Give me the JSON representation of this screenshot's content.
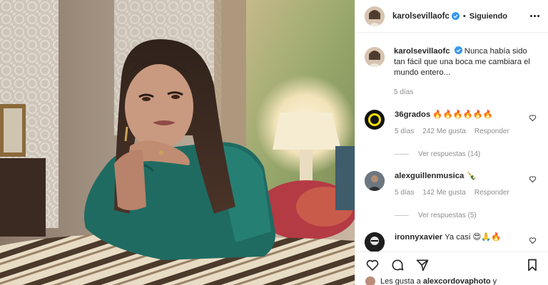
{
  "post": {
    "username": "karolsevillaofc",
    "follow_status": "Siguiendo",
    "separator": "•",
    "caption_text": "Nunca había sido tan fácil que una boca me cambiara el mundo entero...",
    "caption_time": "5 días"
  },
  "comments": [
    {
      "username": "36grados",
      "text": "🔥🔥🔥🔥🔥🔥",
      "time": "5 días",
      "likes": "242 Me gusta",
      "reply_label": "Responder",
      "replies": "Ver respuestas (14)"
    },
    {
      "username": "alexguillenmusica",
      "text": "🍾",
      "time": "5 días",
      "likes": "142 Me gusta",
      "reply_label": "Responder",
      "replies": "Ver respuestas (5)"
    },
    {
      "username": "ironnyxavier",
      "text": "Ya casi 😍🙏🔥"
    }
  ],
  "likes_line": {
    "prefix": "Les gusta a",
    "user": "alexcordovaphoto",
    "suffix": "y"
  },
  "icons": [
    "verified-icon",
    "more-options-icon",
    "heart-icon",
    "comment-icon",
    "share-icon",
    "bookmark-icon"
  ],
  "colors": {
    "verified": "#3897f0",
    "muted": "#8e8e8e",
    "text": "#262626"
  }
}
